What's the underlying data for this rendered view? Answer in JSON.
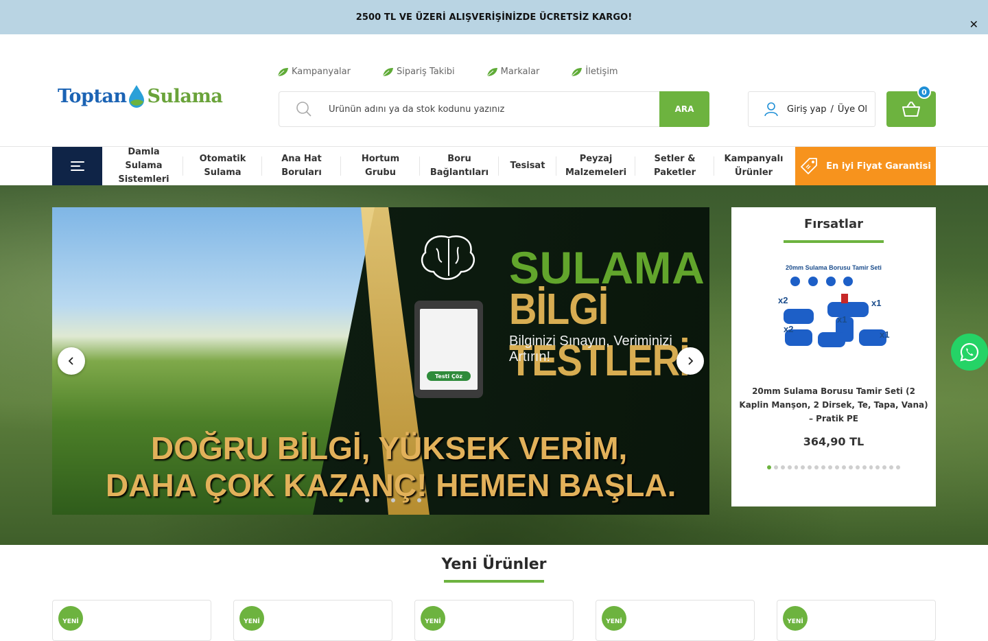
{
  "announcement": {
    "text": "2500 TL VE ÜZERİ ALIŞVERİŞİNİZDE ÜCRETSİZ KARGO!",
    "close": "✕"
  },
  "logo": {
    "part1": "Toptan",
    "part2": "Sulama"
  },
  "toplinks": [
    "Kampanyalar",
    "Sipariş Takibi",
    "Markalar",
    "İletişim"
  ],
  "search": {
    "placeholder": "Ürünün adını ya da stok kodunu yazınız",
    "button": "ARA"
  },
  "account": {
    "login": "Giriş yap",
    "separator": "/",
    "register": "Üye Ol"
  },
  "cart": {
    "count": "0"
  },
  "nav": {
    "items": [
      {
        "line1": "Damla",
        "line2": "Sulama",
        "line3": "Sistemleri"
      },
      {
        "line1": "Otomatik",
        "line2": "Sulama"
      },
      {
        "line1": "Ana Hat",
        "line2": "Boruları"
      },
      {
        "line1": "Hortum",
        "line2": "Grubu"
      },
      {
        "line1": "Boru",
        "line2": "Bağlantıları"
      },
      {
        "line1": "Tesisat"
      },
      {
        "line1": "Peyzaj",
        "line2": "Malzemeleri"
      },
      {
        "line1": "Setler &",
        "line2": "Paketler"
      },
      {
        "line1": "Kampanyalı",
        "line2": "Ürünler"
      }
    ],
    "guarantee": "En iyi Fiyat Garantisi"
  },
  "slider": {
    "title": "SULAMA",
    "subtitle": "BİLGİ TESTLERİ",
    "tagline": "Bilginizi Sınayın, Veriminizi Artırın!",
    "tablet_button": "Testi Çöz",
    "line1": "DOĞRU BİLGİ, YÜKSEK VERİM,",
    "line2": "DAHA ÇOK KAZANÇ! HEMEN BAŞLA.",
    "dot_count": 4,
    "active_dot": 0
  },
  "deals": {
    "title": "Fırsatlar",
    "product_image_caption": "20mm Sulama Borusu Tamir Seti",
    "product_name": "20mm Sulama Borusu Tamir Seti (2 Kaplin Manşon, 2 Dirsek, Te, Tapa, Vana) – Pratik PE",
    "price": "364,90 TL",
    "dot_count": 20,
    "active_dot": 0
  },
  "new_products": {
    "title": "Yeni Ürünler",
    "badge": "YENİ"
  },
  "colors": {
    "green": "#6db33f",
    "navy": "#0f2447",
    "orange": "#f7931d",
    "blue": "#1b63b4",
    "announcement_bg": "#b9d4e3"
  }
}
